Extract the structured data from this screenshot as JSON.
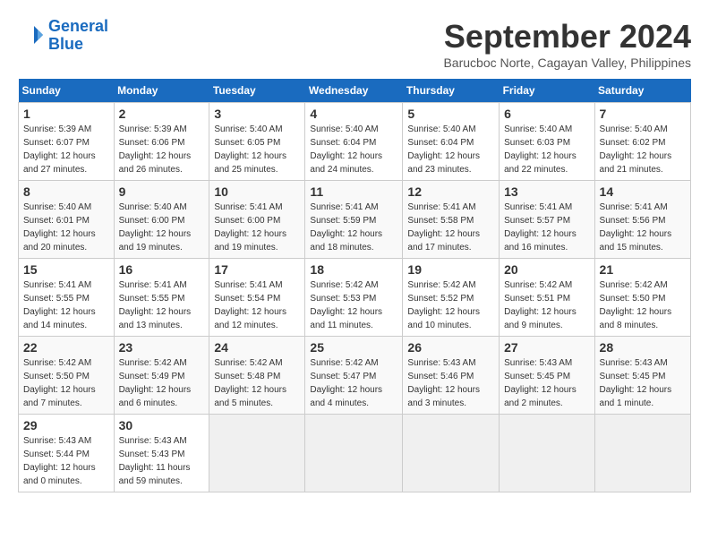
{
  "header": {
    "logo_line1": "General",
    "logo_line2": "Blue",
    "month_title": "September 2024",
    "location": "Barucboc Norte, Cagayan Valley, Philippines"
  },
  "days_of_week": [
    "Sunday",
    "Monday",
    "Tuesday",
    "Wednesday",
    "Thursday",
    "Friday",
    "Saturday"
  ],
  "weeks": [
    [
      {
        "day": "1",
        "sunrise": "Sunrise: 5:39 AM",
        "sunset": "Sunset: 6:07 PM",
        "daylight": "Daylight: 12 hours and 27 minutes."
      },
      {
        "day": "2",
        "sunrise": "Sunrise: 5:39 AM",
        "sunset": "Sunset: 6:06 PM",
        "daylight": "Daylight: 12 hours and 26 minutes."
      },
      {
        "day": "3",
        "sunrise": "Sunrise: 5:40 AM",
        "sunset": "Sunset: 6:05 PM",
        "daylight": "Daylight: 12 hours and 25 minutes."
      },
      {
        "day": "4",
        "sunrise": "Sunrise: 5:40 AM",
        "sunset": "Sunset: 6:04 PM",
        "daylight": "Daylight: 12 hours and 24 minutes."
      },
      {
        "day": "5",
        "sunrise": "Sunrise: 5:40 AM",
        "sunset": "Sunset: 6:04 PM",
        "daylight": "Daylight: 12 hours and 23 minutes."
      },
      {
        "day": "6",
        "sunrise": "Sunrise: 5:40 AM",
        "sunset": "Sunset: 6:03 PM",
        "daylight": "Daylight: 12 hours and 22 minutes."
      },
      {
        "day": "7",
        "sunrise": "Sunrise: 5:40 AM",
        "sunset": "Sunset: 6:02 PM",
        "daylight": "Daylight: 12 hours and 21 minutes."
      }
    ],
    [
      {
        "day": "8",
        "sunrise": "Sunrise: 5:40 AM",
        "sunset": "Sunset: 6:01 PM",
        "daylight": "Daylight: 12 hours and 20 minutes."
      },
      {
        "day": "9",
        "sunrise": "Sunrise: 5:40 AM",
        "sunset": "Sunset: 6:00 PM",
        "daylight": "Daylight: 12 hours and 19 minutes."
      },
      {
        "day": "10",
        "sunrise": "Sunrise: 5:41 AM",
        "sunset": "Sunset: 6:00 PM",
        "daylight": "Daylight: 12 hours and 19 minutes."
      },
      {
        "day": "11",
        "sunrise": "Sunrise: 5:41 AM",
        "sunset": "Sunset: 5:59 PM",
        "daylight": "Daylight: 12 hours and 18 minutes."
      },
      {
        "day": "12",
        "sunrise": "Sunrise: 5:41 AM",
        "sunset": "Sunset: 5:58 PM",
        "daylight": "Daylight: 12 hours and 17 minutes."
      },
      {
        "day": "13",
        "sunrise": "Sunrise: 5:41 AM",
        "sunset": "Sunset: 5:57 PM",
        "daylight": "Daylight: 12 hours and 16 minutes."
      },
      {
        "day": "14",
        "sunrise": "Sunrise: 5:41 AM",
        "sunset": "Sunset: 5:56 PM",
        "daylight": "Daylight: 12 hours and 15 minutes."
      }
    ],
    [
      {
        "day": "15",
        "sunrise": "Sunrise: 5:41 AM",
        "sunset": "Sunset: 5:55 PM",
        "daylight": "Daylight: 12 hours and 14 minutes."
      },
      {
        "day": "16",
        "sunrise": "Sunrise: 5:41 AM",
        "sunset": "Sunset: 5:55 PM",
        "daylight": "Daylight: 12 hours and 13 minutes."
      },
      {
        "day": "17",
        "sunrise": "Sunrise: 5:41 AM",
        "sunset": "Sunset: 5:54 PM",
        "daylight": "Daylight: 12 hours and 12 minutes."
      },
      {
        "day": "18",
        "sunrise": "Sunrise: 5:42 AM",
        "sunset": "Sunset: 5:53 PM",
        "daylight": "Daylight: 12 hours and 11 minutes."
      },
      {
        "day": "19",
        "sunrise": "Sunrise: 5:42 AM",
        "sunset": "Sunset: 5:52 PM",
        "daylight": "Daylight: 12 hours and 10 minutes."
      },
      {
        "day": "20",
        "sunrise": "Sunrise: 5:42 AM",
        "sunset": "Sunset: 5:51 PM",
        "daylight": "Daylight: 12 hours and 9 minutes."
      },
      {
        "day": "21",
        "sunrise": "Sunrise: 5:42 AM",
        "sunset": "Sunset: 5:50 PM",
        "daylight": "Daylight: 12 hours and 8 minutes."
      }
    ],
    [
      {
        "day": "22",
        "sunrise": "Sunrise: 5:42 AM",
        "sunset": "Sunset: 5:50 PM",
        "daylight": "Daylight: 12 hours and 7 minutes."
      },
      {
        "day": "23",
        "sunrise": "Sunrise: 5:42 AM",
        "sunset": "Sunset: 5:49 PM",
        "daylight": "Daylight: 12 hours and 6 minutes."
      },
      {
        "day": "24",
        "sunrise": "Sunrise: 5:42 AM",
        "sunset": "Sunset: 5:48 PM",
        "daylight": "Daylight: 12 hours and 5 minutes."
      },
      {
        "day": "25",
        "sunrise": "Sunrise: 5:42 AM",
        "sunset": "Sunset: 5:47 PM",
        "daylight": "Daylight: 12 hours and 4 minutes."
      },
      {
        "day": "26",
        "sunrise": "Sunrise: 5:43 AM",
        "sunset": "Sunset: 5:46 PM",
        "daylight": "Daylight: 12 hours and 3 minutes."
      },
      {
        "day": "27",
        "sunrise": "Sunrise: 5:43 AM",
        "sunset": "Sunset: 5:45 PM",
        "daylight": "Daylight: 12 hours and 2 minutes."
      },
      {
        "day": "28",
        "sunrise": "Sunrise: 5:43 AM",
        "sunset": "Sunset: 5:45 PM",
        "daylight": "Daylight: 12 hours and 1 minute."
      }
    ],
    [
      {
        "day": "29",
        "sunrise": "Sunrise: 5:43 AM",
        "sunset": "Sunset: 5:44 PM",
        "daylight": "Daylight: 12 hours and 0 minutes."
      },
      {
        "day": "30",
        "sunrise": "Sunrise: 5:43 AM",
        "sunset": "Sunset: 5:43 PM",
        "daylight": "Daylight: 11 hours and 59 minutes."
      },
      null,
      null,
      null,
      null,
      null
    ]
  ]
}
